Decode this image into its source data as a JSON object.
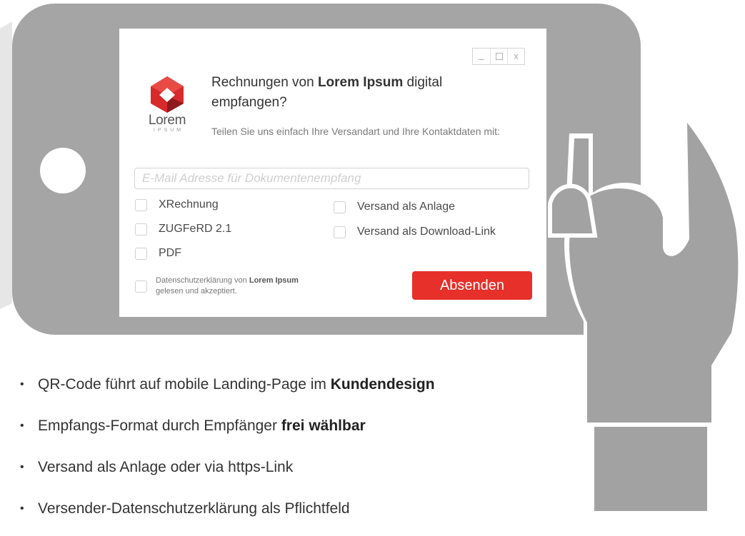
{
  "dialog": {
    "heading_pre": "Rechnungen von ",
    "heading_brand": "Lorem Ipsum",
    "heading_post": " digital empfangen?",
    "subtitle": "Teilen Sie uns einfach Ihre Versandart und Ihre Kontaktdaten mit:",
    "logo": {
      "word": "Lorem",
      "sub": "IPSUM"
    },
    "email_placeholder": "E-Mail Adresse für Dokumentenempfang",
    "formats": [
      "XRechnung",
      "ZUGFeRD 2.1",
      "PDF"
    ],
    "delivery": [
      "Versand als Anlage",
      "Versand als Download-Link"
    ],
    "privacy": {
      "pre": "Datenschutzerklärung von ",
      "brand": "Lorem Ipsum",
      "post": "gelesen und akzeptiert."
    },
    "submit_label": "Absenden",
    "window_controls": {
      "close": "x"
    }
  },
  "bullets": [
    {
      "text": "QR-Code führt auf mobile Landing-Page im ",
      "bold": "Kundendesign"
    },
    {
      "text": "Empfangs-Format durch Empfänger ",
      "bold": "frei wählbar"
    },
    {
      "text": "Versand als Anlage oder via https-Link",
      "bold": ""
    },
    {
      "text": "Versender-Datenschutzerklärung als Pflichtfeld",
      "bold": ""
    }
  ],
  "bullet_glyph": "•",
  "colors": {
    "device": "#a5a5a5",
    "hand": "#a2a2a2",
    "accent": "#e63029",
    "logo_red": "#d8292d",
    "logo_dark": "#8e1a1d"
  }
}
